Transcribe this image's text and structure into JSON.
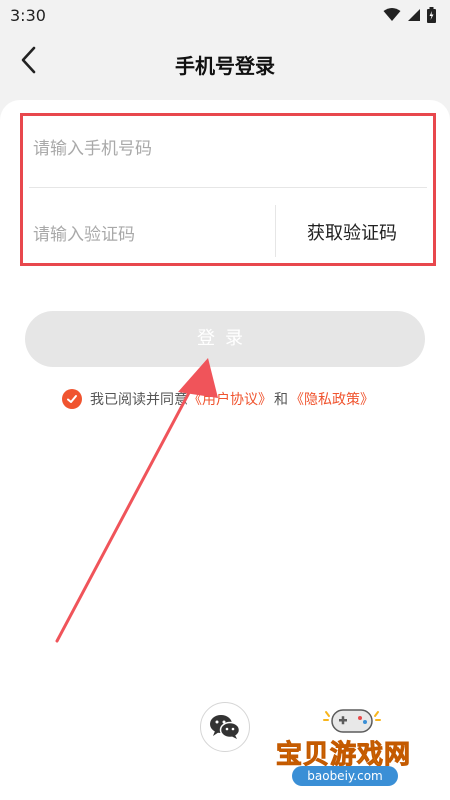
{
  "status_bar": {
    "time": "3:30"
  },
  "header": {
    "title": "手机号登录"
  },
  "form": {
    "phone_placeholder": "请输入手机号码",
    "code_placeholder": "请输入验证码",
    "get_code_label": "获取验证码"
  },
  "login_button": {
    "label": "登录"
  },
  "agreement": {
    "prefix": "我已阅读并同意",
    "user_agreement": "《用户协议》",
    "conjunction": "和",
    "privacy_policy": "《隐私政策》",
    "checked": true
  },
  "watermark": {
    "brand": "宝贝游戏网",
    "url": "baobeiy.com"
  },
  "icons": {
    "back": "chevron-left-icon",
    "check": "check-icon",
    "wechat": "wechat-icon"
  },
  "colors": {
    "accent": "#f0542f",
    "highlight_box": "#e8474d",
    "annotation_arrow": "#f0545a",
    "button_disabled": "#e6e6e6"
  }
}
